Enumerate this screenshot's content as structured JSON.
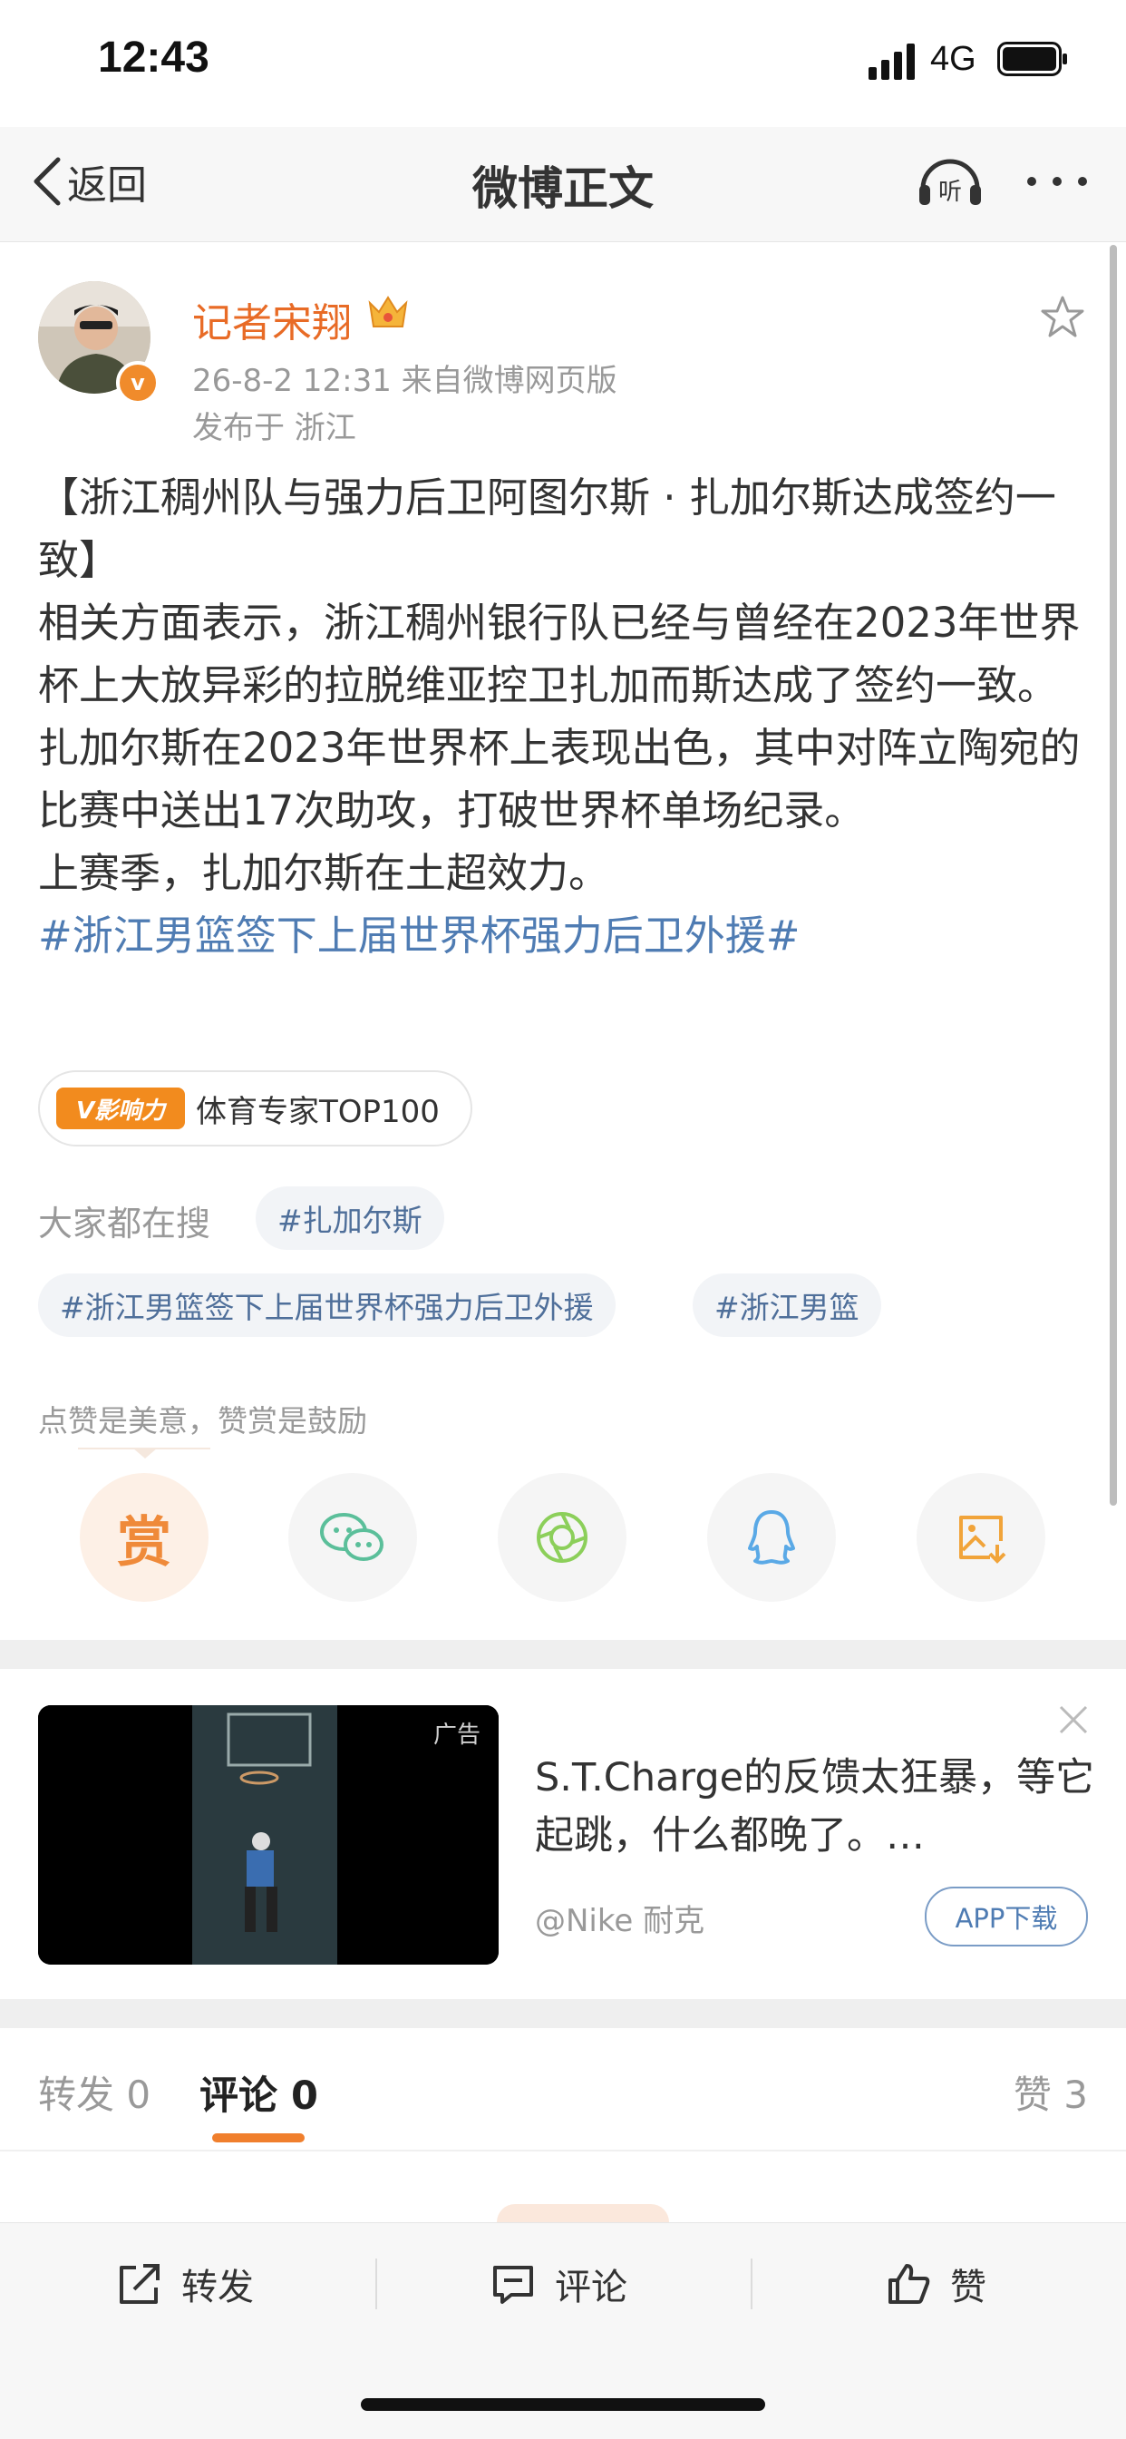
{
  "status_bar": {
    "time": "12:43",
    "network": "4G"
  },
  "nav": {
    "back_label": "返回",
    "title": "微博正文"
  },
  "post": {
    "author": "记者宋翔",
    "meta": "26-8-2 12:31  来自微博网页版",
    "location": "发布于 浙江",
    "content": [
      "【浙江稠州队与强力后卫阿图尔斯 · 扎加尔斯达成签约一致】",
      "相关方面表示，浙江稠州银行队已经与曾经在2023年世界杯上大放异彩的拉脱维亚控卫扎加而斯达成了签约一致。扎加尔斯在2023年世界杯上表现出色，其中对阵立陶宛的比赛中送出17次助攻，打破世界杯单场纪录。",
      "上赛季，扎加尔斯在土超效力。"
    ],
    "hashtag": "#浙江男篮签下上届世界杯强力后卫外援#"
  },
  "badge": {
    "icon_text": "V影响力",
    "text": "体育专家TOP100"
  },
  "search": {
    "label": "大家都在搜",
    "tags": [
      "#扎加尔斯",
      "#浙江男篮签下上届世界杯强力后卫外援",
      "#浙江男篮"
    ]
  },
  "reward": {
    "hint": "点赞是美意，赞赏是鼓励",
    "button_label": "赏"
  },
  "share_icons": [
    "wechat-icon",
    "moments-icon",
    "qq-icon",
    "save-image-icon"
  ],
  "ad": {
    "label": "广告",
    "title": "S.T.Charge的反馈太狂暴，等它起跳，什么都晚了。…",
    "source": "@Nike 耐克",
    "download": "APP下载"
  },
  "tabs": {
    "repost": "转发 0",
    "comment": "评论 0",
    "like": "赞 3"
  },
  "bottom_bar": {
    "repost": "转发",
    "comment": "评论",
    "like": "赞"
  },
  "colors": {
    "accent": "#f07f2d",
    "link": "#4f7cb3",
    "author": "#e86b26"
  }
}
